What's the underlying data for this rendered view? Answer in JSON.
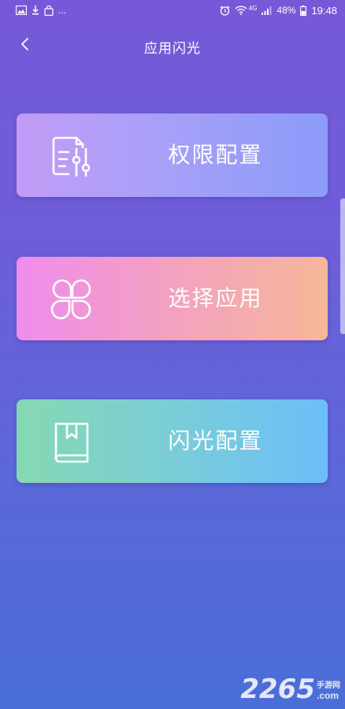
{
  "status_bar": {
    "left_more": "...",
    "network": "4G",
    "battery": "48%",
    "time": "19:48",
    "icons": [
      "image-icon",
      "download-icon",
      "bag-icon",
      "alarm-icon",
      "wifi-icon",
      "signal-icon",
      "battery-icon"
    ]
  },
  "header": {
    "title": "应用闪光",
    "back_icon": "chevron-left-icon"
  },
  "cards": [
    {
      "label": "权限配置",
      "icon": "document-settings-icon"
    },
    {
      "label": "选择应用",
      "icon": "clover-icon"
    },
    {
      "label": "闪光配置",
      "icon": "book-icon"
    }
  ],
  "watermark": {
    "number": "2265",
    "chinese": "手游网",
    "domain": ".com"
  }
}
